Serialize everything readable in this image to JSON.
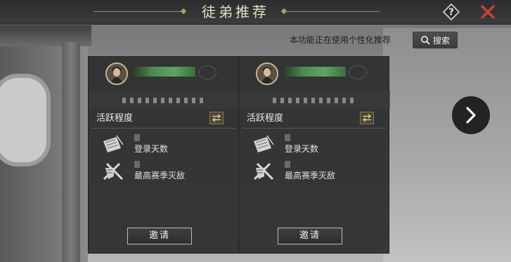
{
  "header": {
    "title": "徒弟推荐",
    "help_icon": "question-diamond-icon",
    "close_icon": "close-x-icon",
    "accent_color": "#c8403a"
  },
  "toolbar": {
    "notice": "本功能正在使用个性化推荐",
    "search_label": "搜索",
    "search_icon": "search-icon"
  },
  "cards": [
    {
      "section_label": "活跃程度",
      "stats": [
        {
          "label": "登录天数",
          "icon": "scroll-brush-icon"
        },
        {
          "label": "最高赛季灭敌",
          "icon": "crossed-blades-icon"
        }
      ],
      "invite_label": "邀请"
    },
    {
      "section_label": "活跃程度",
      "stats": [
        {
          "label": "登录天数",
          "icon": "scroll-brush-icon"
        },
        {
          "label": "最高赛季灭敌",
          "icon": "crossed-blades-icon"
        }
      ],
      "invite_label": "邀请"
    }
  ],
  "navigation": {
    "next_icon": "chevron-right-icon"
  }
}
